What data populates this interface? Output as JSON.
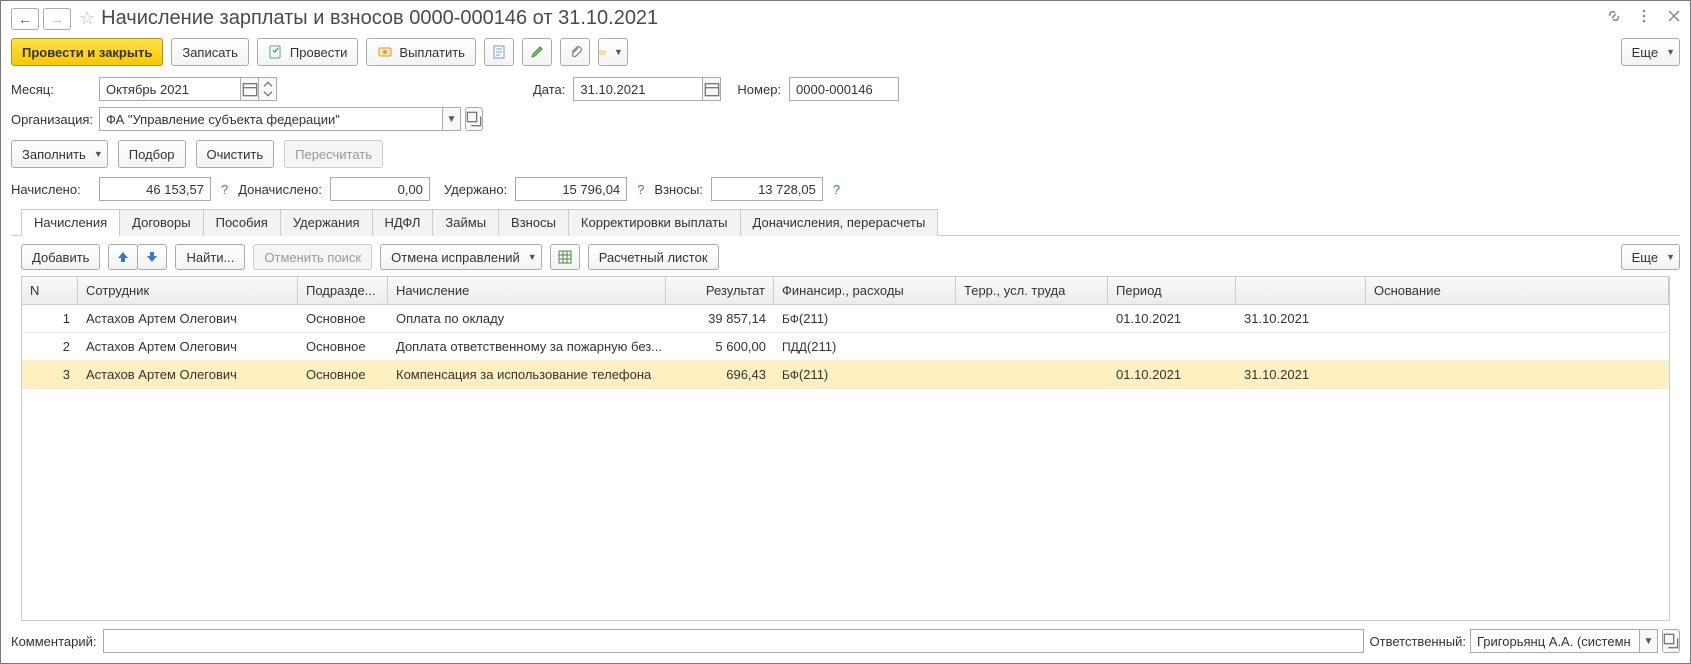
{
  "nav": {
    "back_glyph": "←",
    "fwd_glyph": "→",
    "star_glyph": "☆"
  },
  "title": "Начисление зарплаты и взносов 0000-000146 от 31.10.2021",
  "title_icons": {
    "link": "link-icon",
    "menu": "kebab-icon",
    "close": "close-icon"
  },
  "toolbar": {
    "post_close": "Провести и закрыть",
    "save": "Записать",
    "post": "Провести",
    "pay": "Выплатить",
    "more": "Еще"
  },
  "fields": {
    "month_label": "Месяц:",
    "month_value": "Октябрь 2021",
    "date_label": "Дата:",
    "date_value": "31.10.2021",
    "number_label": "Номер:",
    "number_value": "0000-000146",
    "org_label": "Организация:",
    "org_value": "ФА \"Управление субъекта федерации\""
  },
  "actions": {
    "fill": "Заполнить",
    "pick": "Подбор",
    "clear": "Очистить",
    "recalc": "Пересчитать"
  },
  "totals": {
    "accrued_label": "Начислено:",
    "accrued_value": "46 153,57",
    "extra_accrued_label": "Доначислено:",
    "extra_accrued_value": "0,00",
    "withheld_label": "Удержано:",
    "withheld_value": "15 796,04",
    "contrib_label": "Взносы:",
    "contrib_value": "13 728,05"
  },
  "tabs": [
    "Начисления",
    "Договоры",
    "Пособия",
    "Удержания",
    "НДФЛ",
    "Займы",
    "Взносы",
    "Корректировки выплаты",
    "Доначисления, перерасчеты"
  ],
  "tab_active_index": 0,
  "subbar": {
    "add": "Добавить",
    "find": "Найти...",
    "cancel_search": "Отменить поиск",
    "cancel_fix": "Отмена исправлений",
    "payslip": "Расчетный листок",
    "more": "Еще"
  },
  "columns": {
    "n": "N",
    "emp": "Сотрудник",
    "dep": "Подразде...",
    "acc": "Начисление",
    "res": "Результат",
    "fin": "Финансир., расходы",
    "ter": "Терр., усл. труда",
    "period": "Период",
    "base": "Основание"
  },
  "rows": [
    {
      "n": "1",
      "emp": "Астахов Артем Олегович",
      "dep": "Основное",
      "acc": "Оплата по окладу",
      "res": "39 857,14",
      "fin": "БФ(211)",
      "ter": "",
      "p1": "01.10.2021",
      "p2": "31.10.2021",
      "base": "",
      "sel": false
    },
    {
      "n": "2",
      "emp": "Астахов Артем Олегович",
      "dep": "Основное",
      "acc": "Доплата ответственному за пожарную без...",
      "res": "5 600,00",
      "fin": "ПДД(211)",
      "ter": "",
      "p1": "",
      "p2": "",
      "base": "",
      "sel": false
    },
    {
      "n": "3",
      "emp": "Астахов Артем Олегович",
      "dep": "Основное",
      "acc": "Компенсация за использование телефона",
      "res": "696,43",
      "fin": "БФ(211)",
      "ter": "",
      "p1": "01.10.2021",
      "p2": "31.10.2021",
      "base": "",
      "sel": true
    }
  ],
  "footer": {
    "comment_label": "Комментарий:",
    "comment_value": "",
    "resp_label": "Ответственный:",
    "resp_value": "Григорьянц А.А. (системн"
  }
}
